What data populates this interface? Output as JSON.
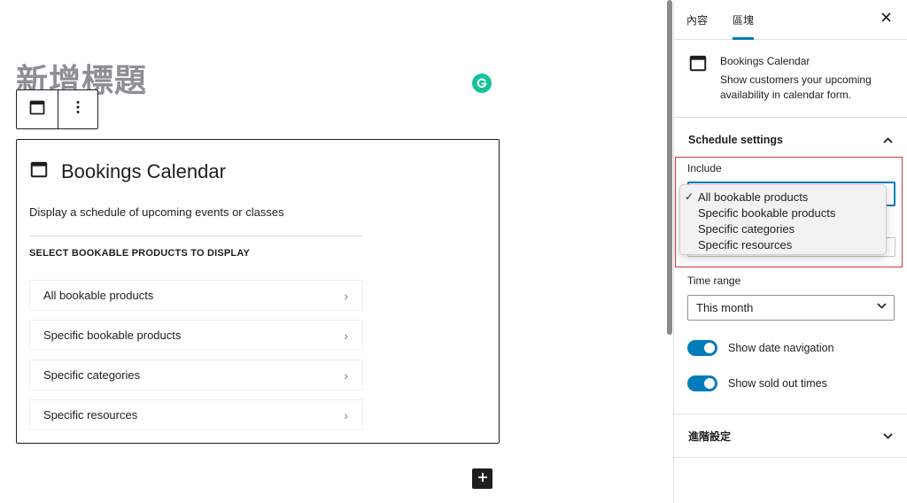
{
  "editor": {
    "post_title_placeholder": "新增標題",
    "toolbar": {
      "block_icon": "calendar-icon",
      "more_icon": "more-vertical-icon"
    },
    "grammarly_icon": "grammarly-icon",
    "block": {
      "icon": "calendar-icon",
      "title": "Bookings Calendar",
      "description": "Display a schedule of upcoming events or classes",
      "subheading": "SELECT BOOKABLE PRODUCTS TO DISPLAY",
      "options": [
        {
          "label": "All bookable products"
        },
        {
          "label": "Specific bookable products"
        },
        {
          "label": "Specific categories"
        },
        {
          "label": "Specific resources"
        }
      ]
    },
    "add_block_icon": "plus-icon"
  },
  "sidebar": {
    "tabs": [
      {
        "label": "內容",
        "active": false
      },
      {
        "label": "區塊",
        "active": true
      }
    ],
    "close_icon": "close-icon",
    "block_card": {
      "icon": "calendar-icon",
      "name": "Bookings Calendar",
      "description": "Show customers your upcoming availability in calendar form."
    },
    "schedule_settings": {
      "title": "Schedule settings",
      "expanded": true,
      "include": {
        "label": "Include",
        "selected": "All bookable products",
        "options": [
          "All bookable products",
          "Specific bookable products",
          "Specific categories",
          "Specific resources"
        ]
      },
      "time_range": {
        "label": "Time range",
        "selected": "This month"
      },
      "toggles": [
        {
          "label": "Show date navigation",
          "checked": true
        },
        {
          "label": "Show sold out times",
          "checked": true
        }
      ]
    },
    "advanced": {
      "title": "進階設定",
      "expanded": false
    }
  },
  "colors": {
    "accent": "#007cba",
    "highlight_border": "#d63638",
    "grammarly": "#15c39a"
  }
}
